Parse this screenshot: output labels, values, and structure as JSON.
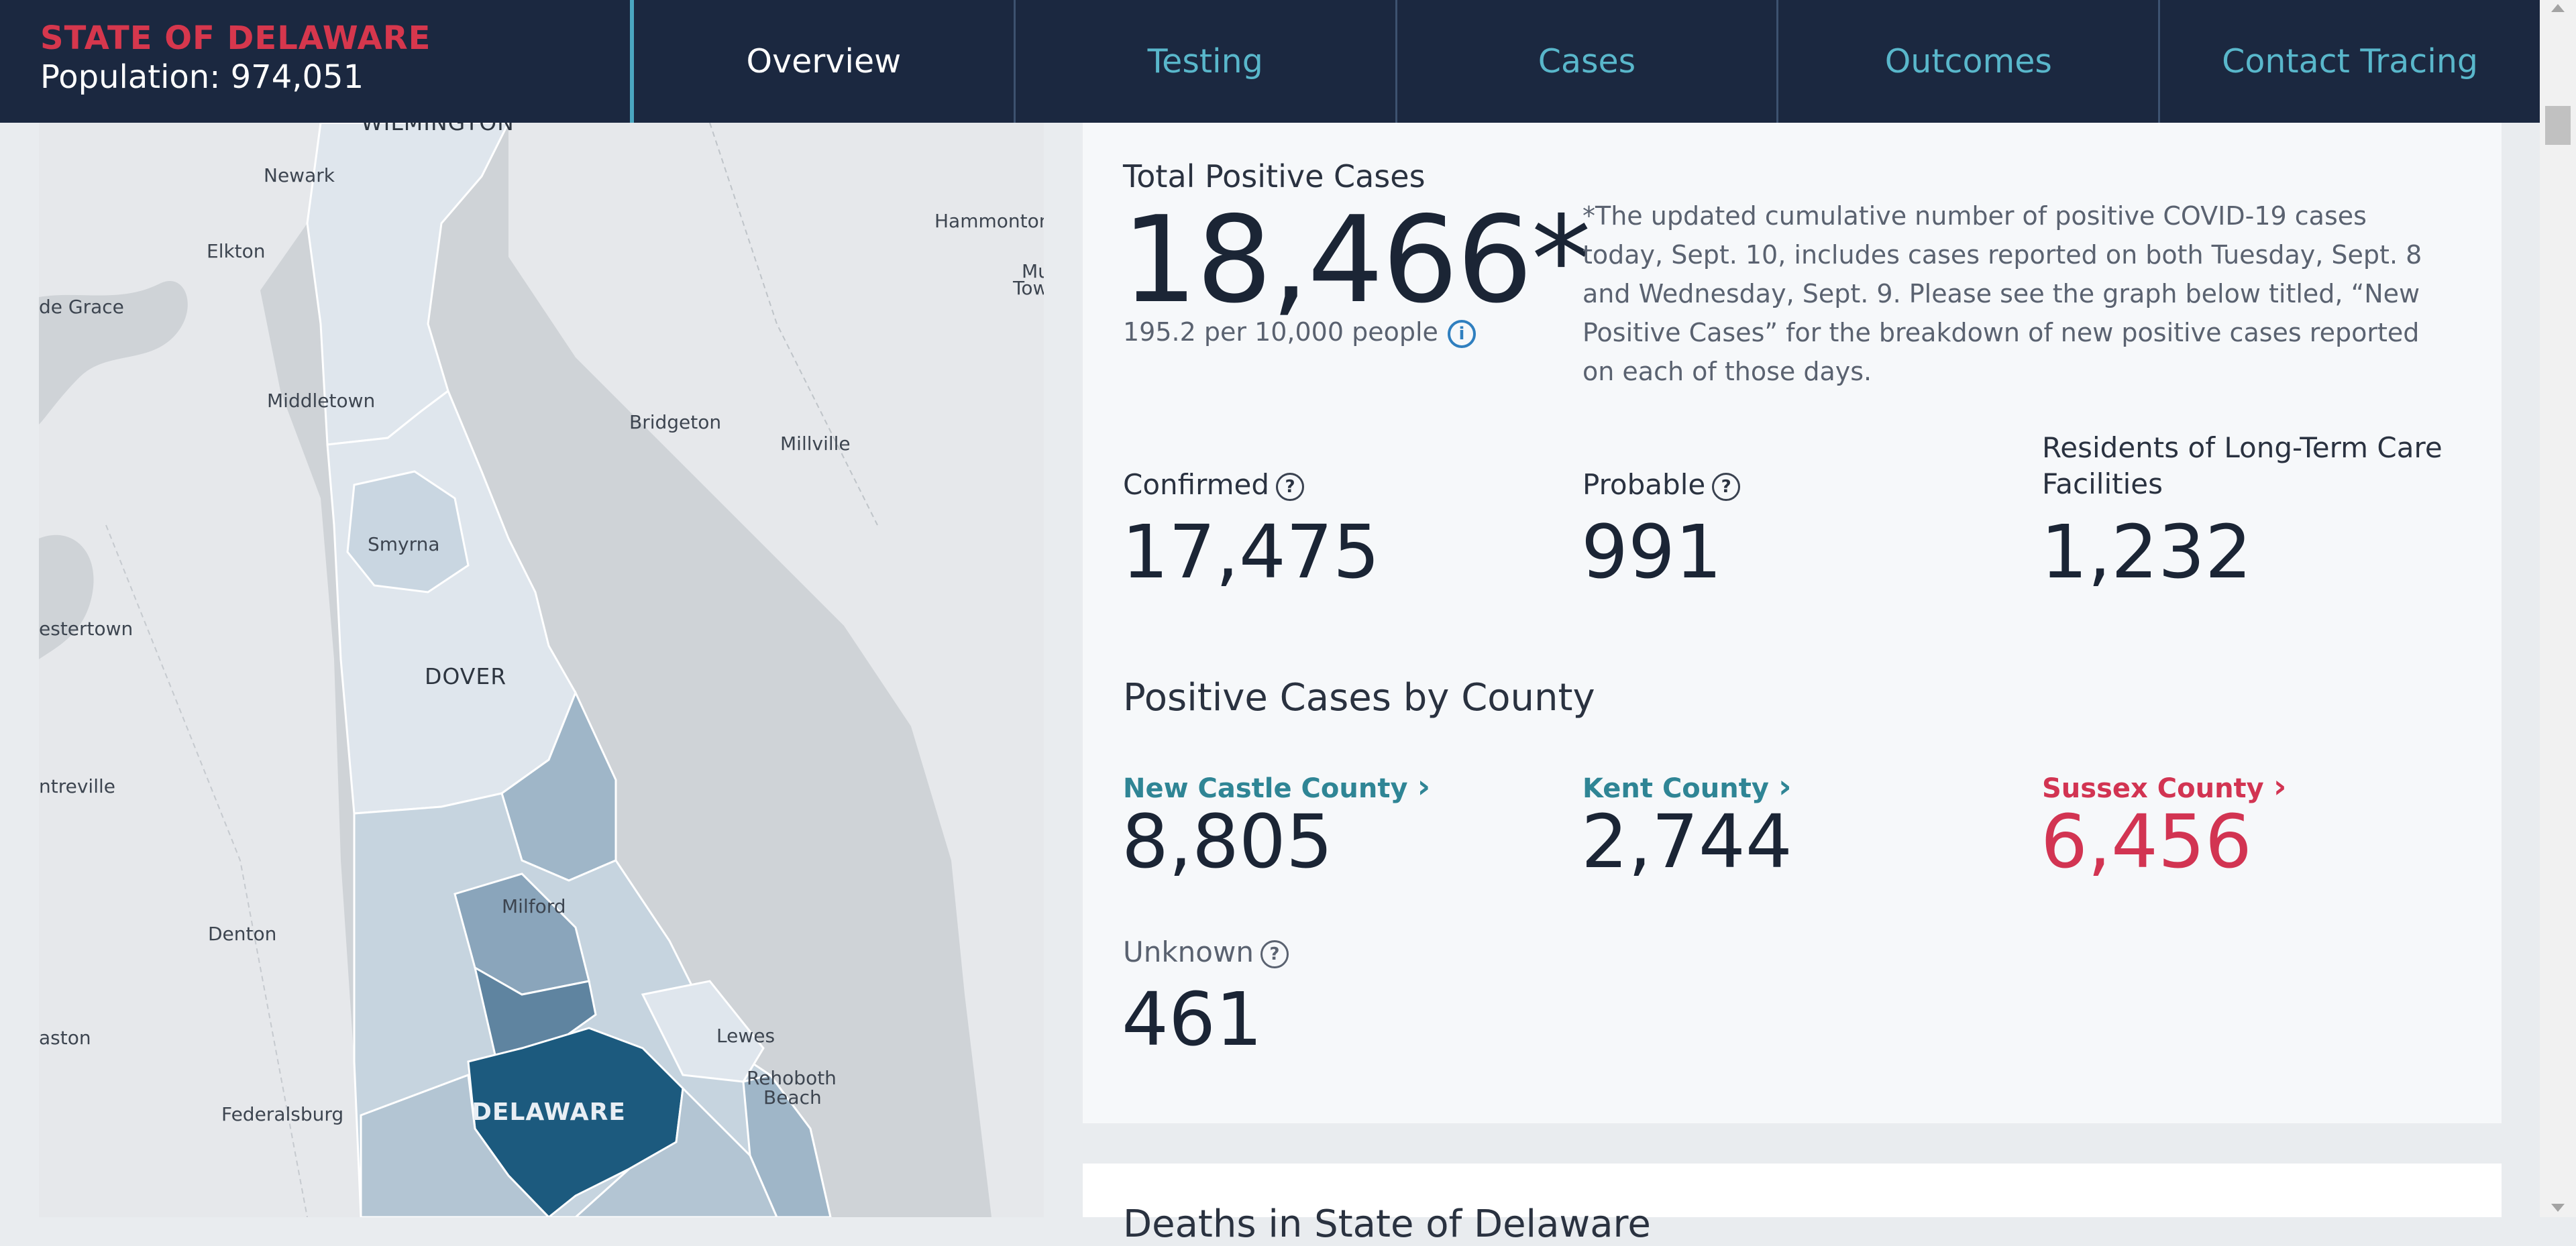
{
  "header": {
    "state": "STATE OF DELAWARE",
    "population": "Population: 974,051"
  },
  "tabs": [
    {
      "label": "Overview",
      "active": true
    },
    {
      "label": "Testing",
      "active": false
    },
    {
      "label": "Cases",
      "active": false
    },
    {
      "label": "Outcomes",
      "active": false
    },
    {
      "label": "Contact Tracing",
      "active": false
    }
  ],
  "map": {
    "labels": {
      "wilmington": "WILMINGTON",
      "newark": "Newark",
      "elkton": "Elkton",
      "havre": "de Grace",
      "middletown": "Middletown",
      "hammonton": "Hammonton",
      "mt": "Mu",
      "tow": "Tow",
      "bridgeton": "Bridgeton",
      "millville": "Millville",
      "smyrna": "Smyrna",
      "chestertown": "estertown",
      "dover": "DOVER",
      "centreville": "ntreville",
      "milford": "Milford",
      "denton": "Denton",
      "easton": "aston",
      "lewes": "Lewes",
      "rehoboth1": "Rehoboth",
      "rehoboth2": "Beach",
      "federalsburg": "Federalsburg",
      "delaware": "DELAWARE"
    },
    "colors": {
      "water": "#cfd3d7",
      "land": "#e4e7ea",
      "light": "#dfe6ed",
      "mid": "#b7c8d6",
      "dark": "#1c5a7e"
    }
  },
  "total": {
    "title": "Total Positive Cases",
    "value": "18,466*",
    "rate": "195.2 per 10,000 people",
    "info_icon": "info-icon",
    "note": "*The updated cumulative number of positive COVID-19 cases today, Sept. 10, includes cases reported on both Tuesday, Sept. 8 and Wednesday, Sept. 9. Please see the graph below titled, “New Positive Cases” for the breakdown of new positive cases reported on each of those days."
  },
  "stats": {
    "confirmed_label": "Confirmed",
    "confirmed_value": "17,475",
    "probable_label": "Probable",
    "probable_value": "991",
    "ltc_label_1": "Residents of Long-Term Care",
    "ltc_label_2": "Facilities",
    "ltc_value": "1,232",
    "help_icon": "question-circle-icon"
  },
  "county_section": {
    "title": "Positive Cases by County",
    "new_castle_label": "New Castle County",
    "new_castle_value": "8,805",
    "kent_label": "Kent County",
    "kent_value": "2,744",
    "sussex_label": "Sussex County",
    "sussex_value": "6,456",
    "unknown_label": "Unknown",
    "unknown_value": "461",
    "chevron": "›",
    "colors": {
      "new_castle": "#2f8595",
      "kent": "#2f8595",
      "sussex": "#d23452"
    }
  },
  "next_section_partial": "Deaths in State of Delaware"
}
